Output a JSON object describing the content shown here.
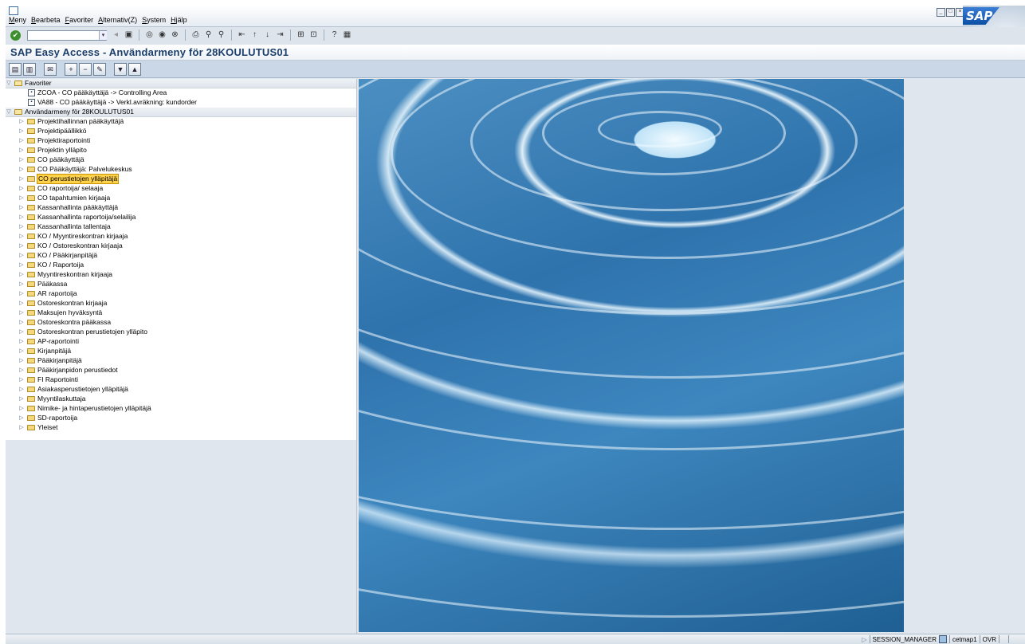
{
  "menu": {
    "items": [
      "Meny",
      "Bearbeta",
      "Favoriter",
      "Alternativ(Z)",
      "System",
      "Hjälp"
    ]
  },
  "window": {
    "logo_text": "SAP"
  },
  "toolbar": {
    "command_field_value": ""
  },
  "title": "SAP Easy Access  -  Användarmeny för 28KOULUTUS01",
  "tree": {
    "favorites_label": "Favoriter",
    "favorites": [
      "ZCOA - CO pääkäyttäjä -> Controlling Area",
      "VA88 - CO pääkäyttäjä -> Verkl.avräkning: kundorder"
    ],
    "user_menu_label": "Användarmeny för 28KOULUTUS01",
    "folders": [
      "Projektihallinnan pääkäyttäjä",
      "Projektipäällikkö",
      "Projektiraportointi",
      "Projektin ylläpito",
      "CO pääkäyttäjä",
      "CO Pääkäyttäjä: Palvelukeskus",
      "CO perustietojen ylläpitäjä",
      "CO raportoija/ selaaja",
      "CO tapahtumien kirjaaja",
      "Kassanhallinta pääkäyttäjä",
      "Kassanhallinta raportoija/selailija",
      "Kassanhallinta tallentaja",
      "KO / Myyntireskontran kirjaaja",
      "KO / Ostoreskontran kirjaaja",
      "KO / Pääkirjanpitäjä",
      "KO / Raportoija",
      "Myyntireskontran kirjaaja",
      "Pääkassa",
      "AR raportoija",
      "Ostoreskontran kirjaaja",
      "Maksujen hyväksyntä",
      "Ostoreskontra pääkassa",
      "Ostoreskontran perustietojen ylläpito",
      "AP-raportointi",
      "Kirjanpitäjä",
      "Pääkirjanpitäjä",
      "Pääkirjanpidon perustiedot",
      "FI Raportointi",
      "Asiakasperustietojen ylläpitäjä",
      "Myyntilaskuttaja",
      "Nimike- ja hintaperustietojen ylläpitäjä",
      "SD-raportoija",
      "Yleiset"
    ],
    "selected_index": 6
  },
  "status": {
    "system": "SESSION_MANAGER",
    "server": "cetmap1",
    "mode": "OVR"
  }
}
